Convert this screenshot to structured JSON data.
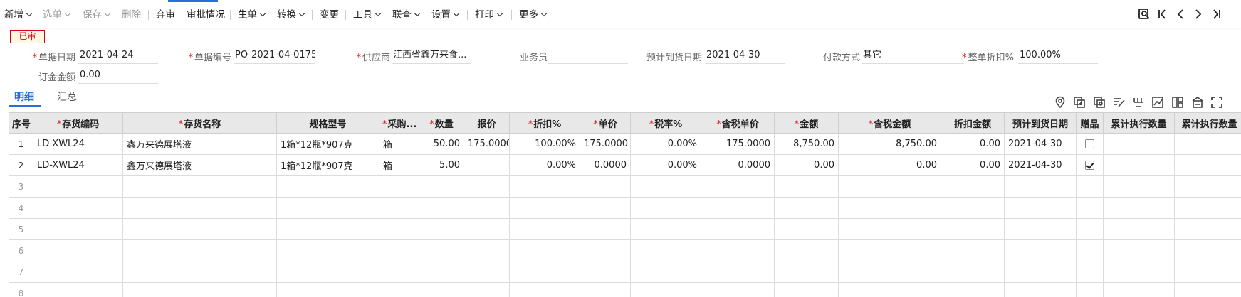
{
  "toolbar": {
    "items": [
      {
        "label": "新增",
        "caret": true,
        "disabled": false
      },
      {
        "label": "选单",
        "caret": true,
        "disabled": true
      },
      {
        "label": "保存",
        "caret": true,
        "disabled": true
      },
      {
        "label": "删除",
        "caret": false,
        "disabled": true
      },
      {
        "label": "弃审",
        "caret": false,
        "disabled": false
      },
      {
        "label": "审批情况",
        "caret": false,
        "disabled": false
      },
      {
        "label": "生单",
        "caret": true,
        "disabled": false
      },
      {
        "label": "转换",
        "caret": true,
        "disabled": false
      },
      {
        "label": "变更",
        "caret": false,
        "disabled": false
      },
      {
        "label": "工具",
        "caret": true,
        "disabled": false
      },
      {
        "label": "联查",
        "caret": true,
        "disabled": false
      },
      {
        "label": "设置",
        "caret": true,
        "disabled": false
      },
      {
        "label": "打印",
        "caret": true,
        "disabled": false
      },
      {
        "label": "更多",
        "caret": true,
        "disabled": false
      }
    ],
    "nav_icons": [
      "search-doc-icon",
      "first-page-icon",
      "prev-page-icon",
      "next-page-icon",
      "last-page-icon"
    ]
  },
  "status": {
    "label": "已审"
  },
  "form": {
    "fields": [
      {
        "label": "单据日期",
        "required": true,
        "value": "2021-04-24"
      },
      {
        "label": "单据编号",
        "required": true,
        "value": "PO-2021-04-0175"
      },
      {
        "label": "供应商",
        "required": true,
        "value": "江西省鑫万来食..."
      },
      {
        "label": "业务员",
        "required": false,
        "value": ""
      },
      {
        "label": "预计到货日期",
        "required": false,
        "value": "2021-04-30"
      },
      {
        "label": "付款方式",
        "required": false,
        "value": "其它"
      },
      {
        "label": "整单折扣%",
        "required": true,
        "value": "100.00%"
      },
      {
        "label": "订金金额",
        "required": false,
        "value": "0.00"
      }
    ]
  },
  "tabs": [
    {
      "label": "明细",
      "active": true
    },
    {
      "label": "汇总",
      "active": false
    }
  ],
  "grid_tools": [
    "locate-icon",
    "copy-row-icon",
    "paste-row-icon",
    "edit-batch-icon",
    "split-icon",
    "chart-icon",
    "layout-icon",
    "warehouse-icon",
    "fullscreen-icon"
  ],
  "grid": {
    "columns": [
      {
        "label": "序号",
        "required": false
      },
      {
        "label": "存货编码",
        "required": true
      },
      {
        "label": "存货名称",
        "required": true
      },
      {
        "label": "规格型号",
        "required": false
      },
      {
        "label": "采购...",
        "required": true
      },
      {
        "label": "数量",
        "required": true
      },
      {
        "label": "报价",
        "required": false
      },
      {
        "label": "折扣%",
        "required": true
      },
      {
        "label": "单价",
        "required": true
      },
      {
        "label": "税率%",
        "required": true
      },
      {
        "label": "含税单价",
        "required": true
      },
      {
        "label": "金额",
        "required": true
      },
      {
        "label": "含税金额",
        "required": true
      },
      {
        "label": "折扣金额",
        "required": false
      },
      {
        "label": "预计到货日期",
        "required": false
      },
      {
        "label": "赠品",
        "required": false
      },
      {
        "label": "累计执行数量",
        "required": false
      },
      {
        "label": "累计执行数量",
        "required": false
      }
    ],
    "rows": [
      {
        "no": "1",
        "code": "LD-XWL24",
        "name": "鑫万来德展塔液",
        "spec": "1箱*12瓶*907克",
        "unit": "箱",
        "qty": "50.00",
        "quote": "175.0000",
        "discount": "100.00%",
        "price": "175.0000",
        "tax": "0.00%",
        "tax_price": "175.0000",
        "amount": "8,750.00",
        "tax_amount": "8,750.00",
        "disc_amount": "0.00",
        "eta": "2021-04-30",
        "gift": false
      },
      {
        "no": "2",
        "code": "LD-XWL24",
        "name": "鑫万来德展塔液",
        "spec": "1箱*12瓶*907克",
        "unit": "箱",
        "qty": "5.00",
        "quote": "",
        "discount": "0.00%",
        "price": "0.0000",
        "tax": "0.00%",
        "tax_price": "0.0000",
        "amount": "0.00",
        "tax_amount": "0.00",
        "disc_amount": "0.00",
        "eta": "2021-04-30",
        "gift": true
      }
    ],
    "empty_rows": [
      "3",
      "4",
      "5",
      "6",
      "7",
      "8"
    ]
  }
}
